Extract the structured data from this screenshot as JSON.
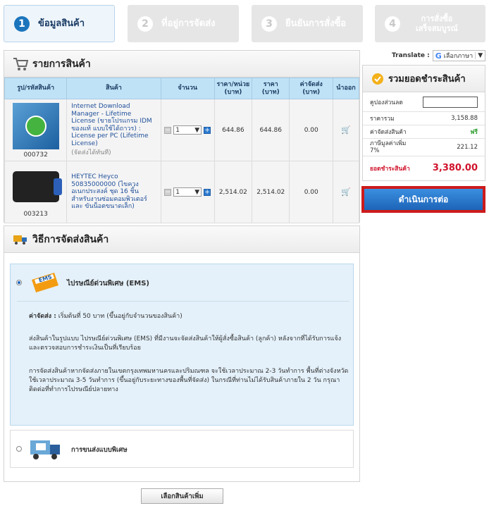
{
  "steps": [
    {
      "num": "1",
      "label": "ข้อมูลสินค้า"
    },
    {
      "num": "2",
      "label": "ที่อยู่การจัดส่ง"
    },
    {
      "num": "3",
      "label": "ยืนยันการสั่งซื้อ"
    },
    {
      "num": "4",
      "label_line1": "การสั่งซื้อ",
      "label_line2": "เสร็จสมบูรณ์"
    }
  ],
  "translate": {
    "label": "Translate :",
    "select": "เลือกภาษา"
  },
  "products": {
    "title": "รายการสินค้า",
    "headers": {
      "code": "รูป/รหัสสินค้า",
      "name": "สินค้า",
      "qty": "จำนวน",
      "unit_price_1": "ราคา/หน่วย",
      "unit_price_2": "(บาท)",
      "price_1": "ราคา",
      "price_2": "(บาท)",
      "ship_1": "ค่าจัดส่ง",
      "ship_2": "(บาท)",
      "remove": "นำออก"
    },
    "rows": [
      {
        "code": "000732",
        "name": "Internet Download Manager - Lifetime License (ขายโปรแกรม IDM ของแท้ แบบใช้ได้ถาวร) : License per PC (Lifetime License)",
        "note": "(จัดส่งได้ทันที)",
        "qty": "1",
        "unit_price": "644.86",
        "price": "644.86",
        "ship": "0.00"
      },
      {
        "code": "003213",
        "name": "HEYTEC Heyco 50835000000 (ไขควงอเนกประสงค์ ชุด 16 ชิ้น สำหรับงานซ่อมคอมพิวเตอร์ และ ขันน็อตขนาดเล็ก)",
        "note": "",
        "qty": "1",
        "unit_price": "2,514.02",
        "price": "2,514.02",
        "ship": "0.00"
      }
    ]
  },
  "summary": {
    "title": "รวมยอดชำระสินค้า",
    "coupon_label": "คูปองส่วนลด",
    "total_label": "ราคารวม",
    "total": "3,158.88",
    "shipping_label": "ค่าจัดส่งสินค้า",
    "shipping": "ฟรี",
    "vat_label_1": "ภาษีมูลค่าเพิ่ม",
    "vat_label_2": "7%",
    "vat": "221.12",
    "grand_label": "ยอดชำระสินค้า",
    "grand": "3,380.00"
  },
  "cta": {
    "label": "ดำเนินการต่อ"
  },
  "shipping": {
    "title": "วิธีการจัดส่งสินค้า",
    "ems": {
      "logo": "EMS",
      "label": "ไปรษณีย์ด่วนพิเศษ (EMS)",
      "fee_label": "ค่าจัดส่ง :",
      "fee_text": "เริ่มต้นที่ 50 บาท (ขึ้นอยู่กับจำนวนของสินค้า)",
      "p1": "ส่งสินค้าในรูปแบบ ไปรษณีย์ด่วนพิเศษ (EMS) ที่มีงานจะจัดส่งสินค้าให้ผู้สั่งซื้อสินค้า (ลูกค้า) หลังจากที่ได้รับการแจ้งและตรวจสอบการชำระเงินเป็นที่เรียบร้อย",
      "p2": "การจัดส่งสินค้าหากจัดส่งภายในเขตกรุงเทพมหานครและปริมณฑล จะใช้เวลาประมาณ 2-3 วันทำการ พื้นที่ต่างจังหวัด ใช้เวลาประมาณ 3-5 วันทำการ (ขึ้นอยู่กับระยะทางของพื้นที่จัดส่ง) ในกรณีที่ท่านไม่ได้รับสินค้าภายใน 2 วัน กรุณาติดต่อที่ทำการไปรษณีย์ปลายทาง"
    },
    "special": {
      "label": "การขนส่งแบบพิเศษ"
    }
  },
  "more_button": {
    "label": "เลือกสินค้าเพิ่ม"
  }
}
